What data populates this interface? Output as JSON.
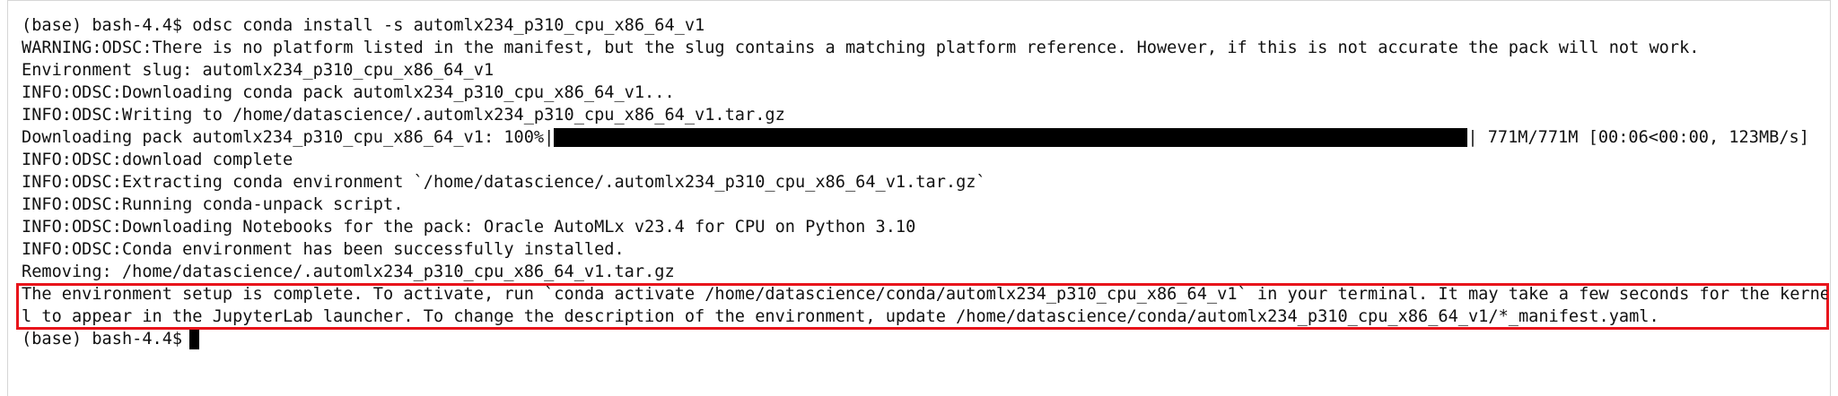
{
  "terminal": {
    "lines": [
      "(base) bash-4.4$ odsc conda install -s automlx234_p310_cpu_x86_64_v1",
      "WARNING:ODSC:There is no platform listed in the manifest, but the slug contains a matching platform reference. However, if this is not accurate the pack will not work.",
      "Environment slug: automlx234_p310_cpu_x86_64_v1",
      "INFO:ODSC:Downloading conda pack automlx234_p310_cpu_x86_64_v1...",
      "INFO:ODSC:Writing to /home/datascience/.automlx234_p310_cpu_x86_64_v1.tar.gz"
    ],
    "progress": {
      "prefix": "Downloading pack automlx234_p310_cpu_x86_64_v1: 100%|",
      "suffix": "| 771M/771M [00:06<00:00, 123MB/s]",
      "percent": 100
    },
    "lines_after": [
      "INFO:ODSC:download complete",
      "INFO:ODSC:Extracting conda environment `/home/datascience/.automlx234_p310_cpu_x86_64_v1.tar.gz`",
      "INFO:ODSC:Running conda-unpack script.",
      "INFO:ODSC:Downloading Notebooks for the pack: Oracle AutoMLx v23.4 for CPU on Python 3.10",
      "INFO:ODSC:Conda environment has been successfully installed.",
      "Removing: /home/datascience/.automlx234_p310_cpu_x86_64_v1.tar.gz"
    ],
    "highlighted": [
      "The environment setup is complete. To activate, run `conda activate /home/datascience/conda/automlx234_p310_cpu_x86_64_v1` in your terminal. It may take a few seconds for the kerne",
      "l to appear in the JupyterLab launcher. To change the description of the environment, update /home/datascience/conda/automlx234_p310_cpu_x86_64_v1/*_manifest.yaml."
    ],
    "prompt": "(base) bash-4.4$",
    "highlight_color": "#e8141b"
  }
}
